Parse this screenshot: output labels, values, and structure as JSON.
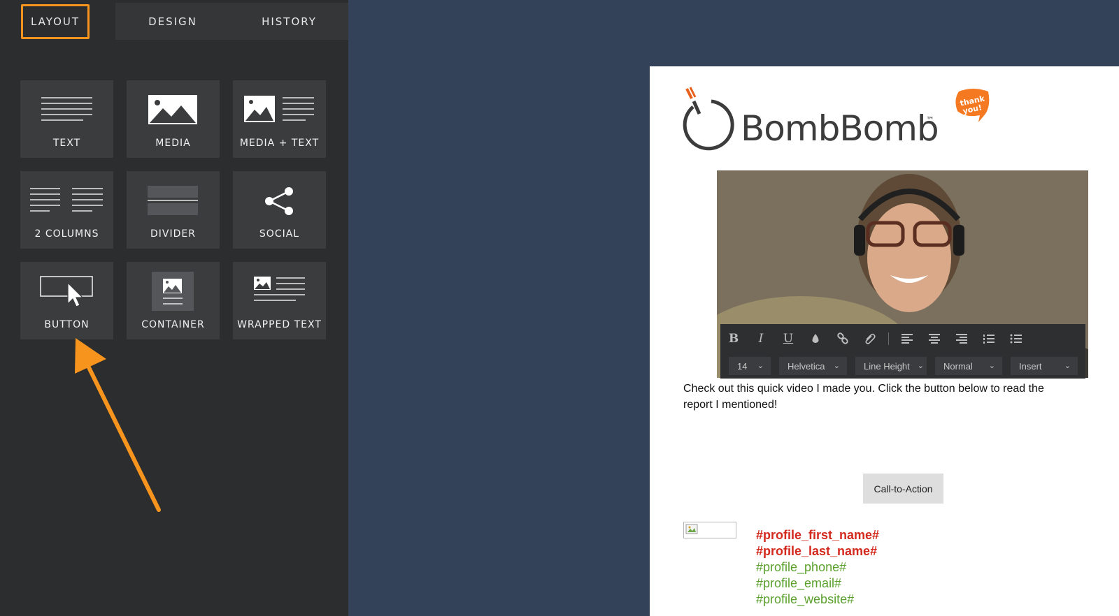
{
  "tabs": [
    {
      "label": "LAYOUT"
    },
    {
      "label": "DESIGN"
    },
    {
      "label": "HISTORY"
    }
  ],
  "tiles": [
    {
      "label": "TEXT"
    },
    {
      "label": "MEDIA"
    },
    {
      "label": "MEDIA + TEXT"
    },
    {
      "label": "2 COLUMNS"
    },
    {
      "label": "DIVIDER"
    },
    {
      "label": "SOCIAL"
    },
    {
      "label": "BUTTON"
    },
    {
      "label": "CONTAINER"
    },
    {
      "label": "WRAPPED TEXT"
    }
  ],
  "colors": {
    "accent": "#f7941d",
    "sidebar_bg": "#2c2d2f",
    "canvas_bg": "#334259",
    "profile_name": "#d42a1e",
    "profile_contact": "#5aa02c"
  },
  "email": {
    "logo_text": "BombBomb",
    "logo_tm": "™",
    "badge_text_1": "thank",
    "badge_text_2": "you!",
    "toolbar": {
      "font_size": "14",
      "font_family": "Helvetica",
      "line_height": "Line Height",
      "format": "Normal",
      "insert": "Insert"
    },
    "body_text": "Check out this quick video I made you. Click the button below to read the report I mentioned!",
    "cta_label": "Call-to-Action",
    "profile": {
      "first_name": "#profile_first_name#",
      "last_name": "#profile_last_name#",
      "phone": "#profile_phone#",
      "email": "#profile_email#",
      "website": "#profile_website#"
    }
  }
}
